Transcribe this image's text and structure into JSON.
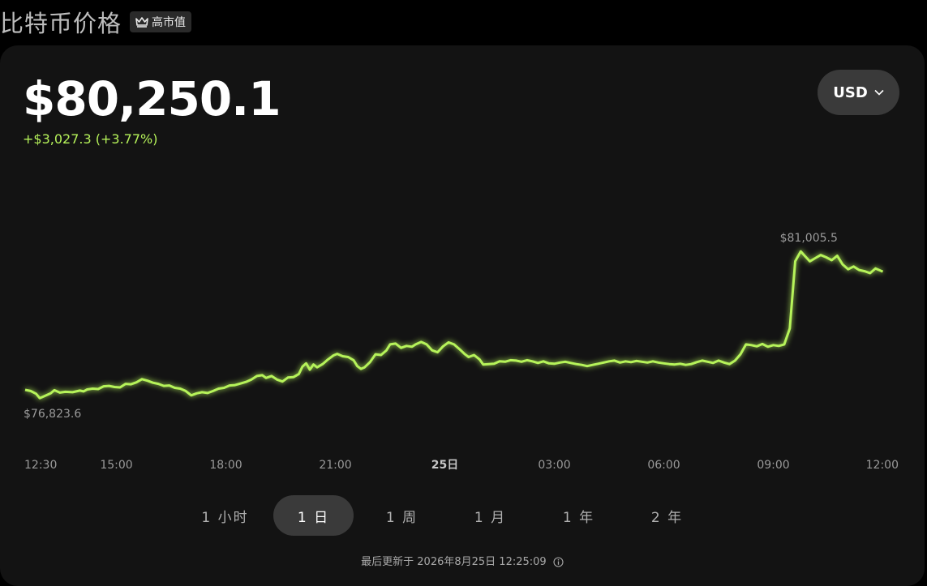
{
  "header": {
    "title": "比特币价格",
    "badge": "高市值",
    "badge_icon": "crown-icon"
  },
  "price": {
    "value": "$80,250.1",
    "change": "+$3,027.3 (+3.77%)",
    "change_color": "#b6f35a"
  },
  "currency": {
    "selected": "USD",
    "icon": "chevron-down-icon"
  },
  "chart_data": {
    "type": "line",
    "color": "#b6f35a",
    "ylim": [
      76500,
      81300
    ],
    "x_ticks": [
      {
        "t": 0,
        "label": "12:30"
      },
      {
        "t": 2.5,
        "label": "15:00"
      },
      {
        "t": 5.5,
        "label": "18:00"
      },
      {
        "t": 8.5,
        "label": "21:00"
      },
      {
        "t": 11.5,
        "label": "25日",
        "bold": true
      },
      {
        "t": 14.5,
        "label": "03:00"
      },
      {
        "t": 17.5,
        "label": "06:00"
      },
      {
        "t": 20.5,
        "label": "09:00"
      },
      {
        "t": 23.5,
        "label": "12:00"
      }
    ],
    "points": [
      [
        0.0,
        77050
      ],
      [
        0.15,
        77020
      ],
      [
        0.3,
        76950
      ],
      [
        0.4,
        76840
      ],
      [
        0.55,
        76900
      ],
      [
        0.7,
        76960
      ],
      [
        0.8,
        77040
      ],
      [
        0.95,
        76980
      ],
      [
        1.1,
        77000
      ],
      [
        1.3,
        76990
      ],
      [
        1.5,
        77030
      ],
      [
        1.6,
        77010
      ],
      [
        1.7,
        77060
      ],
      [
        1.85,
        77080
      ],
      [
        2.0,
        77070
      ],
      [
        2.15,
        77140
      ],
      [
        2.3,
        77150
      ],
      [
        2.45,
        77120
      ],
      [
        2.6,
        77110
      ],
      [
        2.75,
        77200
      ],
      [
        2.9,
        77190
      ],
      [
        3.05,
        77240
      ],
      [
        3.2,
        77320
      ],
      [
        3.35,
        77280
      ],
      [
        3.5,
        77230
      ],
      [
        3.65,
        77200
      ],
      [
        3.8,
        77150
      ],
      [
        3.95,
        77160
      ],
      [
        4.1,
        77100
      ],
      [
        4.25,
        77080
      ],
      [
        4.4,
        77020
      ],
      [
        4.55,
        76910
      ],
      [
        4.7,
        76960
      ],
      [
        4.85,
        76990
      ],
      [
        5.0,
        76970
      ],
      [
        5.15,
        77020
      ],
      [
        5.3,
        77080
      ],
      [
        5.45,
        77100
      ],
      [
        5.6,
        77160
      ],
      [
        5.75,
        77170
      ],
      [
        5.9,
        77210
      ],
      [
        6.05,
        77250
      ],
      [
        6.2,
        77310
      ],
      [
        6.35,
        77400
      ],
      [
        6.5,
        77420
      ],
      [
        6.6,
        77350
      ],
      [
        6.75,
        77400
      ],
      [
        6.9,
        77310
      ],
      [
        7.05,
        77260
      ],
      [
        7.2,
        77360
      ],
      [
        7.35,
        77370
      ],
      [
        7.5,
        77450
      ],
      [
        7.6,
        77640
      ],
      [
        7.7,
        77720
      ],
      [
        7.8,
        77560
      ],
      [
        7.9,
        77690
      ],
      [
        8.0,
        77620
      ],
      [
        8.15,
        77700
      ],
      [
        8.3,
        77820
      ],
      [
        8.45,
        77920
      ],
      [
        8.55,
        77960
      ],
      [
        8.7,
        77900
      ],
      [
        8.85,
        77880
      ],
      [
        9.0,
        77800
      ],
      [
        9.1,
        77650
      ],
      [
        9.2,
        77580
      ],
      [
        9.3,
        77620
      ],
      [
        9.45,
        77750
      ],
      [
        9.6,
        77950
      ],
      [
        9.75,
        77930
      ],
      [
        9.9,
        78050
      ],
      [
        10.0,
        78200
      ],
      [
        10.15,
        78220
      ],
      [
        10.3,
        78110
      ],
      [
        10.45,
        78160
      ],
      [
        10.6,
        78140
      ],
      [
        10.7,
        78200
      ],
      [
        10.85,
        78260
      ],
      [
        11.0,
        78200
      ],
      [
        11.15,
        78050
      ],
      [
        11.3,
        78000
      ],
      [
        11.45,
        78150
      ],
      [
        11.6,
        78250
      ],
      [
        11.75,
        78200
      ],
      [
        11.9,
        78080
      ],
      [
        12.05,
        77950
      ],
      [
        12.15,
        77880
      ],
      [
        12.3,
        77930
      ],
      [
        12.45,
        77820
      ],
      [
        12.55,
        77690
      ],
      [
        12.7,
        77700
      ],
      [
        12.85,
        77710
      ],
      [
        13.0,
        77770
      ],
      [
        13.15,
        77760
      ],
      [
        13.3,
        77800
      ],
      [
        13.45,
        77790
      ],
      [
        13.6,
        77760
      ],
      [
        13.75,
        77800
      ],
      [
        13.9,
        77770
      ],
      [
        14.05,
        77730
      ],
      [
        14.2,
        77770
      ],
      [
        14.35,
        77720
      ],
      [
        14.5,
        77710
      ],
      [
        14.65,
        77740
      ],
      [
        14.8,
        77760
      ],
      [
        14.95,
        77730
      ],
      [
        15.1,
        77700
      ],
      [
        15.25,
        77680
      ],
      [
        15.4,
        77650
      ],
      [
        15.55,
        77680
      ],
      [
        15.7,
        77710
      ],
      [
        15.85,
        77740
      ],
      [
        16.0,
        77770
      ],
      [
        16.15,
        77790
      ],
      [
        16.3,
        77740
      ],
      [
        16.45,
        77770
      ],
      [
        16.6,
        77750
      ],
      [
        16.75,
        77780
      ],
      [
        16.9,
        77760
      ],
      [
        17.05,
        77740
      ],
      [
        17.2,
        77770
      ],
      [
        17.35,
        77740
      ],
      [
        17.5,
        77720
      ],
      [
        17.65,
        77700
      ],
      [
        17.8,
        77690
      ],
      [
        17.95,
        77710
      ],
      [
        18.1,
        77680
      ],
      [
        18.25,
        77700
      ],
      [
        18.4,
        77750
      ],
      [
        18.55,
        77790
      ],
      [
        18.7,
        77760
      ],
      [
        18.85,
        77730
      ],
      [
        19.0,
        77790
      ],
      [
        19.15,
        77740
      ],
      [
        19.3,
        77700
      ],
      [
        19.45,
        77790
      ],
      [
        19.6,
        77950
      ],
      [
        19.75,
        78200
      ],
      [
        19.9,
        78180
      ],
      [
        20.05,
        78150
      ],
      [
        20.2,
        78210
      ],
      [
        20.35,
        78140
      ],
      [
        20.5,
        78180
      ],
      [
        20.65,
        78160
      ],
      [
        20.8,
        78200
      ],
      [
        20.95,
        78600
      ],
      [
        21.1,
        80300
      ],
      [
        21.25,
        80550
      ],
      [
        21.35,
        80450
      ],
      [
        21.5,
        80300
      ],
      [
        21.65,
        80380
      ],
      [
        21.8,
        80460
      ],
      [
        21.95,
        80400
      ],
      [
        22.1,
        80330
      ],
      [
        22.25,
        80440
      ],
      [
        22.4,
        80220
      ],
      [
        22.55,
        80100
      ],
      [
        22.7,
        80170
      ],
      [
        22.85,
        80080
      ],
      [
        23.0,
        80050
      ],
      [
        23.15,
        80000
      ],
      [
        23.3,
        80120
      ],
      [
        23.5,
        80040
      ]
    ],
    "annotations": {
      "high": "$81,005.5",
      "low": "$76,823.6"
    }
  },
  "ranges": {
    "items": [
      {
        "label": "1 小时",
        "name": "range-1h"
      },
      {
        "label": "1 日",
        "name": "range-1d",
        "active": true
      },
      {
        "label": "1 周",
        "name": "range-1w"
      },
      {
        "label": "1 月",
        "name": "range-1m"
      },
      {
        "label": "1 年",
        "name": "range-1y"
      },
      {
        "label": "2 年",
        "name": "range-2y"
      }
    ]
  },
  "footer": {
    "updated": "最后更新于 2026年8月25日 12:25:09",
    "info_icon": "info-icon"
  }
}
